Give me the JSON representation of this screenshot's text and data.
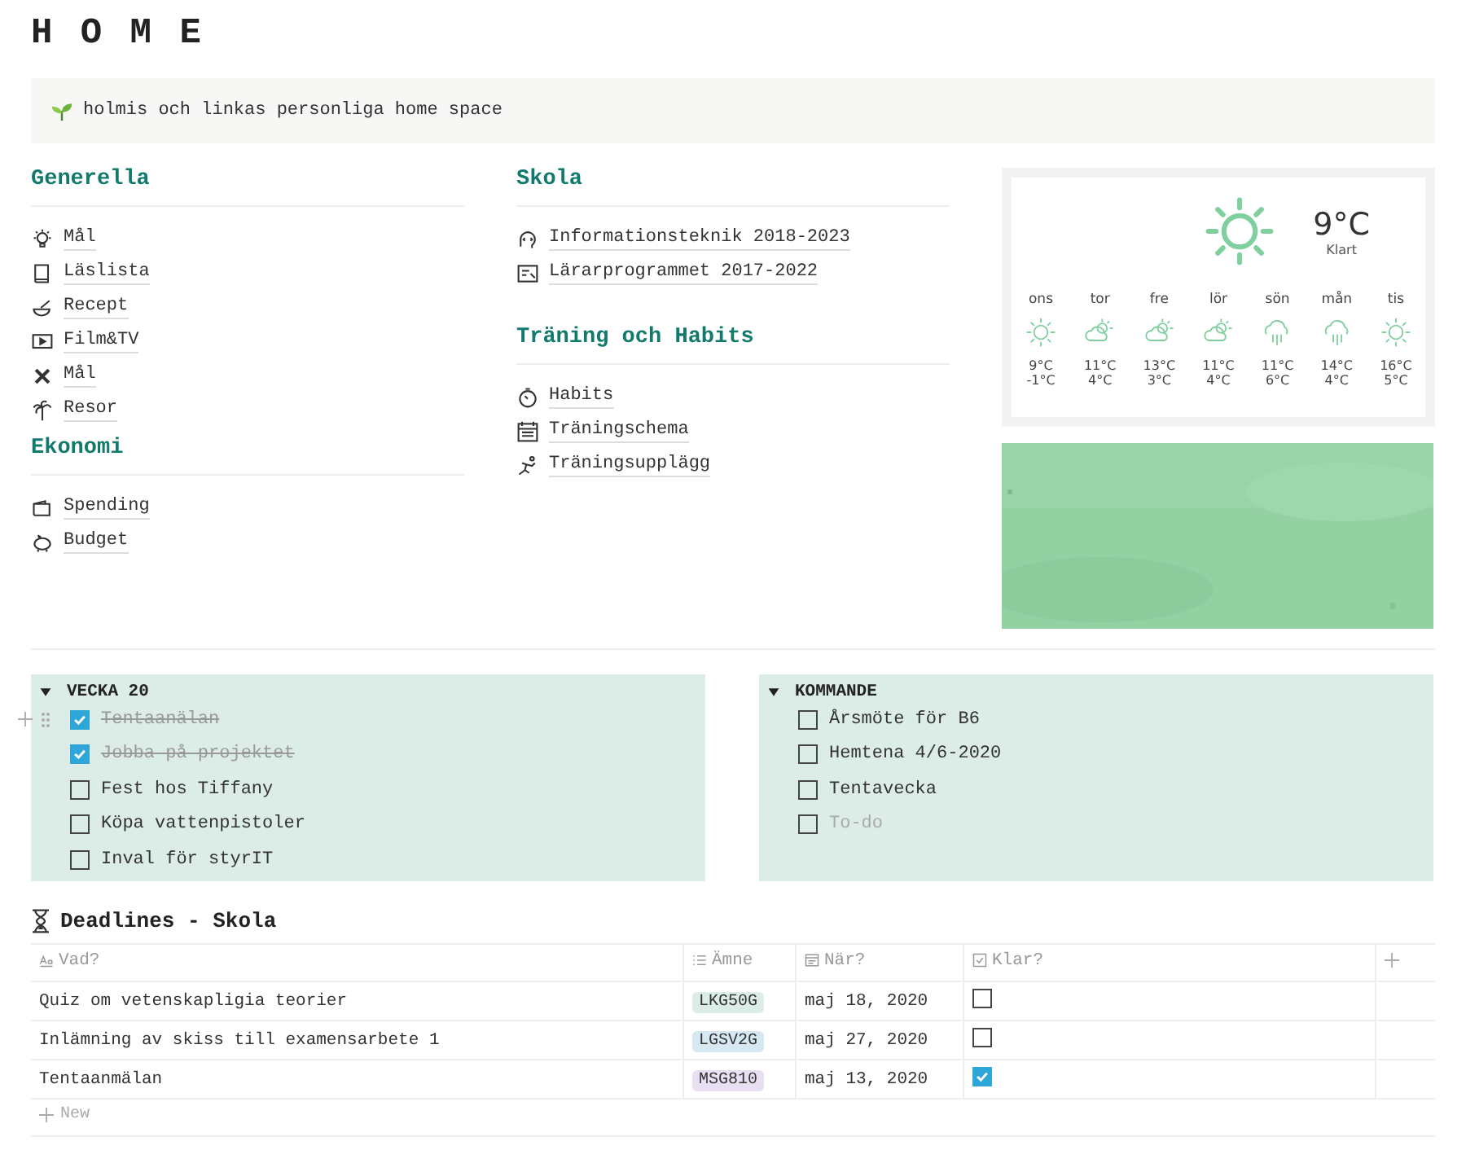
{
  "title": "H O M E",
  "callout": {
    "text": "holmis och linkas personliga home space"
  },
  "sections": [
    {
      "heading": "Generella",
      "links": [
        {
          "label": "Mål"
        },
        {
          "label": "Läslista"
        },
        {
          "label": "Recept"
        },
        {
          "label": "Film&TV"
        },
        {
          "label": "Mål"
        },
        {
          "label": "Resor"
        }
      ]
    },
    {
      "heading": "Ekonomi",
      "links": [
        {
          "label": "Spending"
        },
        {
          "label": "Budget"
        }
      ]
    },
    {
      "heading": "Skola",
      "links": [
        {
          "label": "Informationsteknik 2018-2023"
        },
        {
          "label": "Lärarprogrammet 2017-2022"
        }
      ]
    },
    {
      "heading": "Träning och Habits",
      "links": [
        {
          "label": "Habits"
        },
        {
          "label": "Träningschema"
        },
        {
          "label": "Träningsupplägg"
        }
      ]
    }
  ],
  "weather": {
    "temp": "9°C",
    "condition": "Klart",
    "days": [
      {
        "day": "ons",
        "kind": "sun",
        "high": "9°C",
        "low": "-1°C"
      },
      {
        "day": "tor",
        "kind": "cloud",
        "high": "11°C",
        "low": "4°C"
      },
      {
        "day": "fre",
        "kind": "cloud",
        "high": "13°C",
        "low": "3°C"
      },
      {
        "day": "lör",
        "kind": "cloud",
        "high": "11°C",
        "low": "4°C"
      },
      {
        "day": "sön",
        "kind": "rain",
        "high": "11°C",
        "low": "6°C"
      },
      {
        "day": "mån",
        "kind": "rain",
        "high": "14°C",
        "low": "4°C"
      },
      {
        "day": "tis",
        "kind": "sun",
        "high": "16°C",
        "low": "5°C"
      }
    ]
  },
  "toggles": [
    {
      "title": "VECKA 20",
      "expanded": true,
      "todos": [
        {
          "text": "Tentaanälan",
          "checked": true
        },
        {
          "text": "Jobba på projektet ",
          "checked": true
        },
        {
          "text": "Fest hos Tiffany",
          "checked": false
        },
        {
          "text": "Köpa vattenpistoler",
          "checked": false
        },
        {
          "text": "Inval för styrIT",
          "checked": false
        }
      ]
    },
    {
      "title": "KOMMANDE",
      "expanded": true,
      "todos": [
        {
          "text": "Årsmöte för B6",
          "checked": false
        },
        {
          "text": "Hemtena 4/6-2020",
          "checked": false
        },
        {
          "text": "Tentavecka",
          "checked": false
        },
        {
          "placeholder": "To-do",
          "checked": false
        }
      ]
    }
  ],
  "deadlines": {
    "title": "Deadlines - Skola",
    "columns": [
      "Vad?",
      "Ämne",
      "När?",
      "Klar?"
    ],
    "rows": [
      {
        "what": "Quiz om vetenskapligia teorier",
        "course": "LKG50G",
        "color": "#dbede6",
        "when": "maj 18, 2020",
        "done": false
      },
      {
        "what": "Inlämning av skiss till examensarbete 1",
        "course": "LGSV2G",
        "color": "#d6e8f2",
        "when": "maj 27, 2020",
        "done": false
      },
      {
        "what": "Tentaanmälan",
        "course": "MSG810",
        "color": "#e8dff2",
        "when": "maj 13, 2020",
        "done": true
      }
    ],
    "new_label": "New"
  }
}
